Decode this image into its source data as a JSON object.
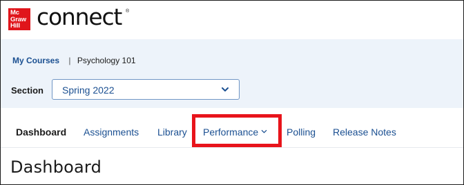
{
  "header": {
    "logo_lines": [
      "Mc",
      "Graw",
      "Hill"
    ],
    "brand_name": "connect",
    "brand_mark": "®"
  },
  "breadcrumb": {
    "courses_link": "My Courses",
    "separator": "|",
    "current": "Psychology 101"
  },
  "section": {
    "label": "Section",
    "selected": "Spring 2022",
    "icon": "chevron-down-icon"
  },
  "nav": {
    "items": [
      {
        "label": "Dashboard",
        "active": true
      },
      {
        "label": "Assignments",
        "active": false
      },
      {
        "label": "Library",
        "active": false
      },
      {
        "label": "Performance",
        "active": false,
        "has_dropdown": true
      },
      {
        "label": "Polling",
        "active": false
      },
      {
        "label": "Release Notes",
        "active": false
      }
    ]
  },
  "page": {
    "title": "Dashboard"
  },
  "colors": {
    "brand_red": "#e0151b",
    "link_blue": "#1a4f91",
    "subbar_bg": "#edf3fa",
    "highlight_red": "#e8141b"
  }
}
